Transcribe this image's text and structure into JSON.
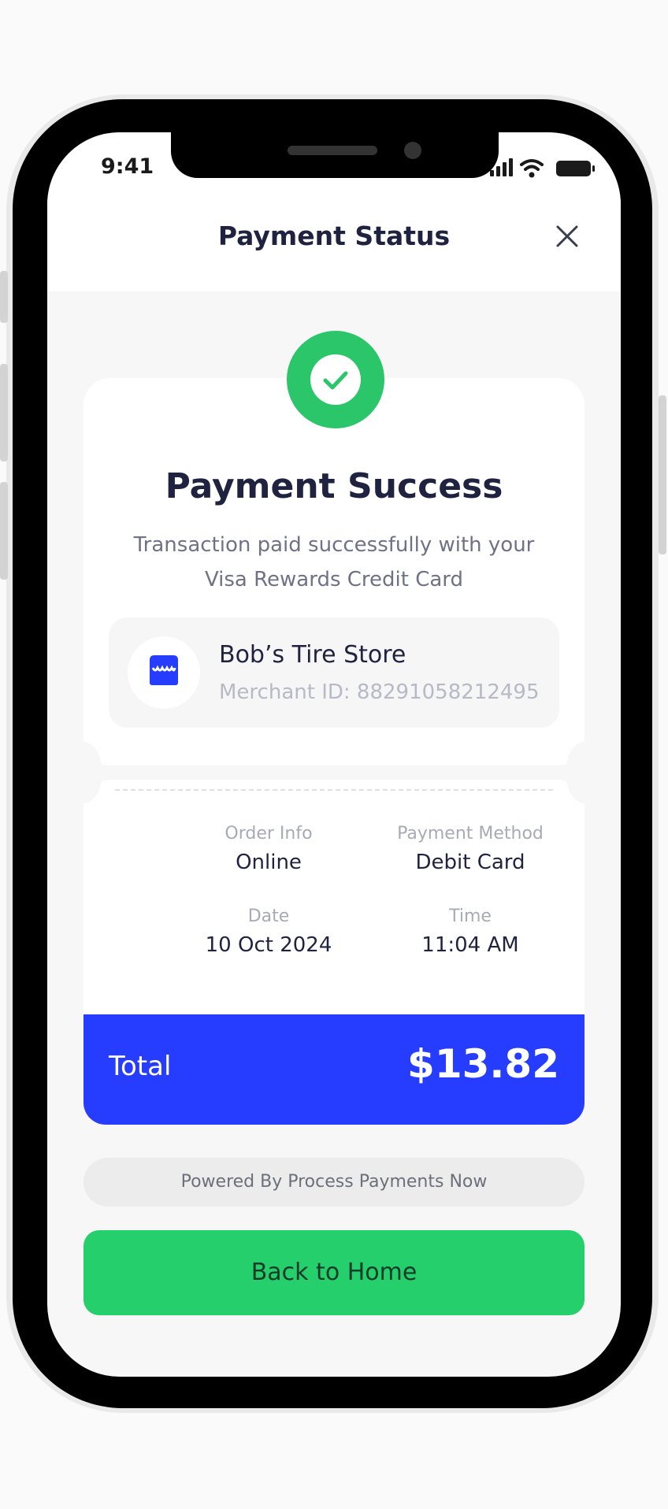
{
  "status_bar": {
    "time": "9:41",
    "icons": [
      "cellular-signal-icon",
      "wifi-icon",
      "battery-icon"
    ]
  },
  "header": {
    "title": "Payment Status",
    "close_icon": "close-icon"
  },
  "status": {
    "icon": "check-icon",
    "title": "Payment Success",
    "description": "Transaction paid successfully with your Visa Rewards Credit Card"
  },
  "merchant": {
    "icon": "store-icon",
    "name": "Bob’s Tire Store",
    "id_text": "Merchant ID: 88291058212495"
  },
  "details": {
    "order_info_label": "Order Info",
    "order_info_value": "Online",
    "payment_method_label": "Payment Method",
    "payment_method_value": "Debit Card",
    "date_label": "Date",
    "date_value": "10 Oct 2024",
    "time_label": "Time",
    "time_value": "11:04 AM"
  },
  "total": {
    "label": "Total",
    "amount": "$13.82"
  },
  "footer": {
    "powered_by": "Powered By Process Payments Now",
    "home_button": "Back to Home"
  },
  "colors": {
    "accent_blue": "#263dff",
    "success_green": "#2bc56a",
    "button_green": "#25cf6c",
    "text_dark": "#1f2340"
  }
}
